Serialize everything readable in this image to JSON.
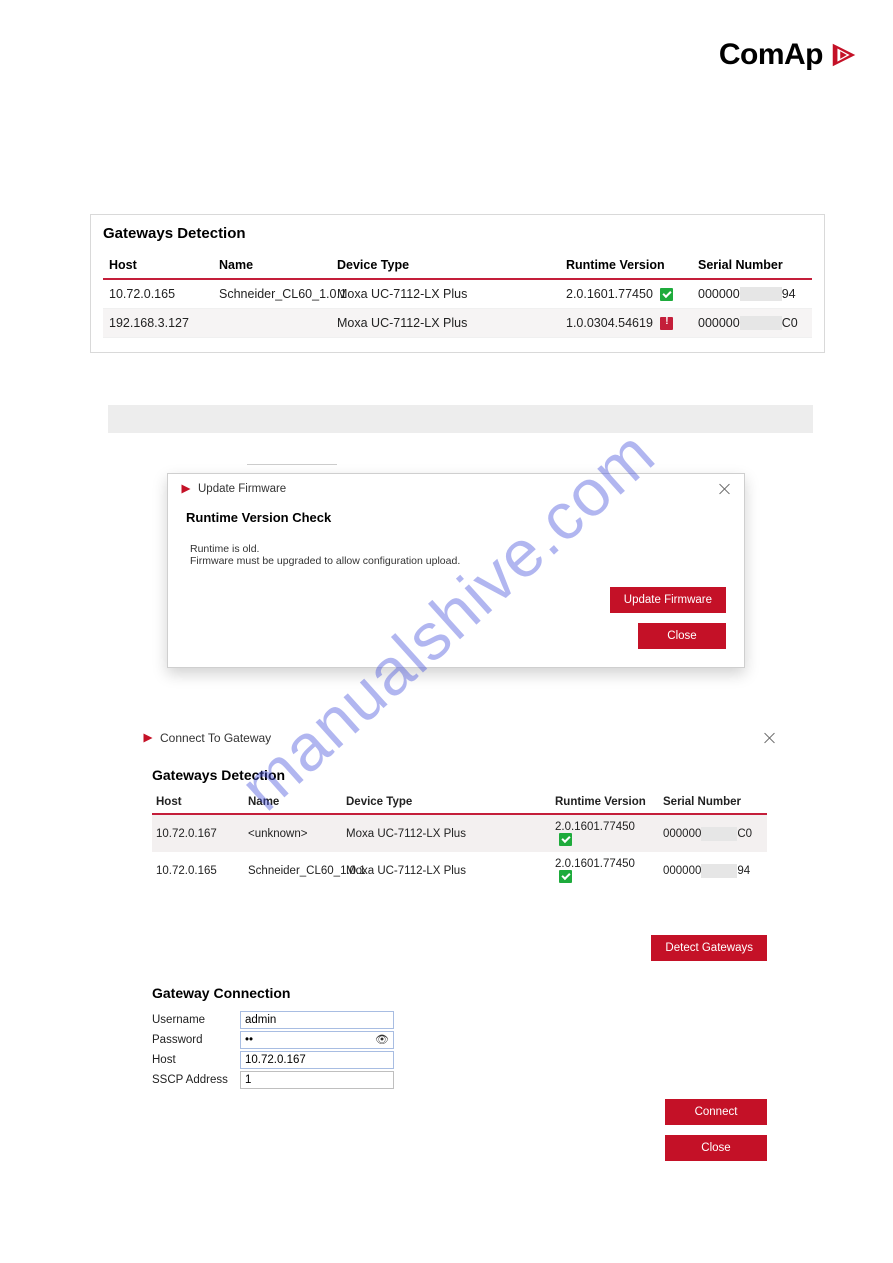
{
  "logo": {
    "text1": "Com",
    "text2": "Ap"
  },
  "watermark": "manualshive.com",
  "panel1": {
    "title": "Gateways Detection",
    "headers": {
      "host": "Host",
      "name": "Name",
      "device": "Device Type",
      "version": "Runtime Version",
      "serial": "Serial Number"
    },
    "rows": [
      {
        "host": "10.72.0.165",
        "name": "Schneider_CL60_1.0.1",
        "device": "Moxa UC-7112-LX Plus",
        "version": "2.0.1601.77450",
        "status": "ok",
        "serial_prefix": "000000",
        "serial_suffix": "94"
      },
      {
        "host": "192.168.3.127",
        "name": "",
        "device": "Moxa UC-7112-LX Plus",
        "version": "1.0.0304.54619",
        "status": "err",
        "serial_prefix": "000000",
        "serial_suffix": "C0"
      }
    ]
  },
  "dialog1": {
    "title": "Update Firmware",
    "heading": "Runtime Version Check",
    "msg1": "Runtime is old.",
    "msg2": "Firmware must be upgraded to allow configuration upload.",
    "update_btn": "Update Firmware",
    "close_btn": "Close"
  },
  "dialog2": {
    "title": "Connect To Gateway",
    "gw_title": "Gateways Detection",
    "headers": {
      "host": "Host",
      "name": "Name",
      "device": "Device Type",
      "version": "Runtime Version",
      "serial": "Serial Number"
    },
    "rows": [
      {
        "host": "10.72.0.167",
        "name": "<unknown>",
        "device": "Moxa UC-7112-LX Plus",
        "version": "2.0.1601.77450",
        "status": "ok",
        "serial_prefix": "000000",
        "serial_suffix": "C0"
      },
      {
        "host": "10.72.0.165",
        "name": "Schneider_CL60_1.0.1",
        "device": "Moxa UC-7112-LX Plus",
        "version": "2.0.1601.77450",
        "status": "ok",
        "serial_prefix": "000000",
        "serial_suffix": "94"
      }
    ],
    "detect_btn": "Detect Gateways",
    "gc_title": "Gateway Connection",
    "form": {
      "username_label": "Username",
      "username_value": "admin",
      "password_label": "Password",
      "password_value": "••",
      "host_label": "Host",
      "host_value": "10.72.0.167",
      "sscp_label": "SSCP Address",
      "sscp_value": "1"
    },
    "connect_btn": "Connect",
    "close_btn": "Close"
  }
}
